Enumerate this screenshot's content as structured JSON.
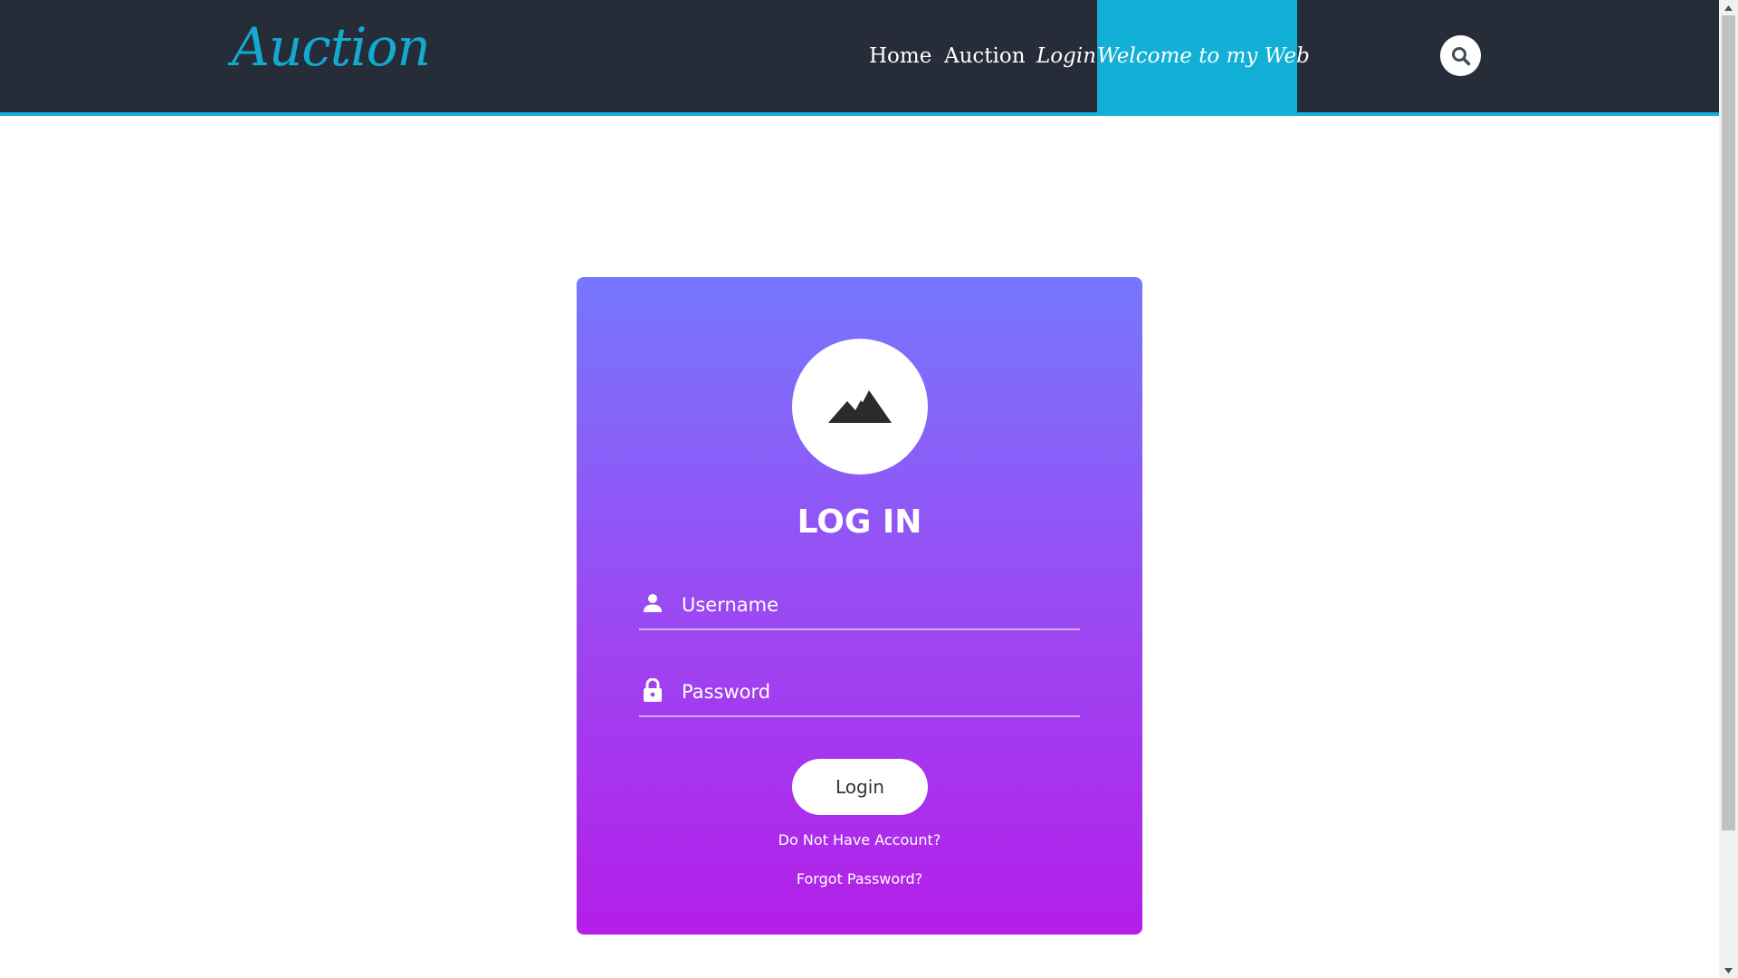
{
  "header": {
    "logo": "Auction",
    "nav": {
      "home": "Home",
      "auction": "Auction",
      "login": "Login",
      "welcome": "Welcome to my Web"
    },
    "search_icon": "search-icon"
  },
  "login_card": {
    "avatar_icon": "mountain-icon",
    "title": "LOG IN",
    "username": {
      "icon": "user-icon",
      "placeholder": "Username",
      "value": ""
    },
    "password": {
      "icon": "lock-icon",
      "placeholder": "Password",
      "value": ""
    },
    "login_button": "Login",
    "register_link": "Do Not Have Account?",
    "forgot_link": "Forgot Password?"
  },
  "colors": {
    "navbar": "#262d39",
    "accent": "#12b0d6",
    "card_gradient_top": "#7677ff",
    "card_gradient_bottom": "#b41ee9"
  }
}
